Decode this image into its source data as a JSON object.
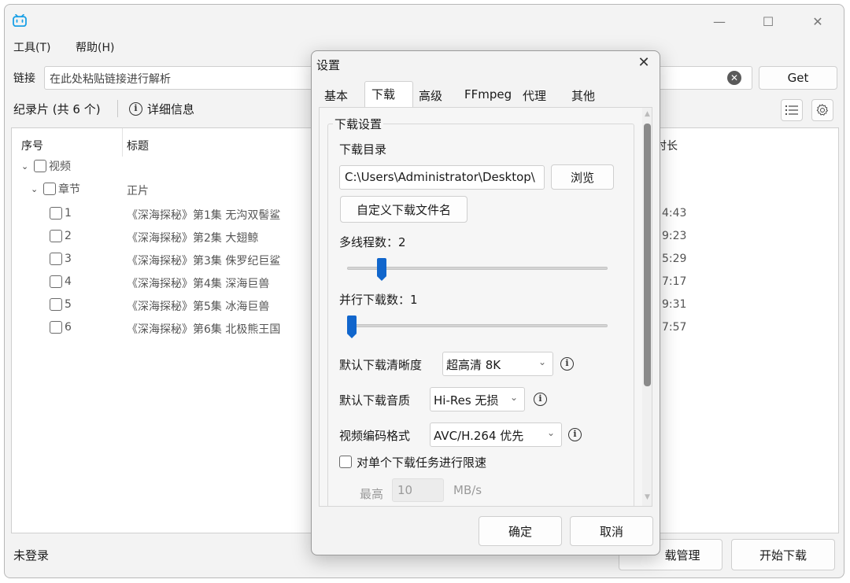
{
  "window": {
    "minimize_glyph": "—",
    "maximize_glyph": "☐",
    "close_glyph": "✕"
  },
  "menu": {
    "tools": "工具(T)",
    "help": "帮助(H)"
  },
  "url_bar": {
    "label": "链接",
    "placeholder": "在此处粘贴链接进行解析",
    "clear_glyph": "✕",
    "get_label": "Get"
  },
  "summary": {
    "text": "纪录片 (共 6 个)",
    "info_glyph": "i",
    "info_label": "详细信息"
  },
  "table": {
    "headers": {
      "index": "序号",
      "title": "标题",
      "duration": "时长"
    },
    "group_video": "视频",
    "group_chapter": "章节",
    "chapter_title": "正片",
    "rows": [
      {
        "index": "1",
        "title": "《深海探秘》第1集 无沟双髻鲨",
        "duration": "4:43"
      },
      {
        "index": "2",
        "title": "《深海探秘》第2集 大翅鲸",
        "duration": "9:23"
      },
      {
        "index": "3",
        "title": "《深海探秘》第3集 侏罗纪巨鲨",
        "duration": "5:29"
      },
      {
        "index": "4",
        "title": "《深海探秘》第4集 深海巨兽",
        "duration": "7:17"
      },
      {
        "index": "5",
        "title": "《深海探秘》第5集 冰海巨兽",
        "duration": "9:31"
      },
      {
        "index": "6",
        "title": "《深海探秘》第6集 北极熊王国",
        "duration": "7:57"
      }
    ]
  },
  "status": {
    "login": "未登录",
    "download_manager_partial": "载管理",
    "start_download": "开始下载"
  },
  "settings": {
    "title": "设置",
    "close_glyph": "✕",
    "tabs": [
      "基本",
      "下载",
      "高级",
      "FFmpeg",
      "代理",
      "其他"
    ],
    "active_tab": "下载",
    "group_title": "下载设置",
    "download_dir_label": "下载目录",
    "download_dir_value": "C:\\Users\\Administrator\\Desktop\\",
    "browse_label": "浏览",
    "custom_filename_label": "自定义下载文件名",
    "threads_label": "多线程数：2",
    "threads_level": 0.12,
    "parallel_label": "并行下载数：1",
    "parallel_level": 0.0,
    "quality_label": "默认下载清晰度",
    "quality_value": "超高清 8K",
    "audio_label": "默认下载音质",
    "audio_value": "Hi-Res 无损",
    "codec_label": "视频编码格式",
    "codec_value": "AVC/H.264 优先",
    "limit_label": "对单个下载任务进行限速",
    "max_label": "最高",
    "max_value": "10",
    "max_unit": "MB/s",
    "ok_label": "确定",
    "cancel_label": "取消"
  }
}
